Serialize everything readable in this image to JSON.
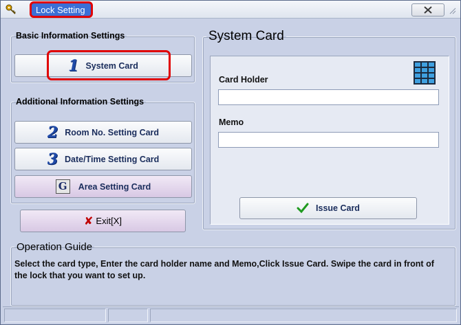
{
  "window": {
    "title": "Lock Setting"
  },
  "icons": {
    "app": "key-icon",
    "close": "close-icon",
    "keypad": "keypad-icon",
    "exit": "x-icon",
    "issue": "check-icon"
  },
  "basic_group": {
    "legend": "Basic Information Settings",
    "buttons": [
      {
        "num": "1",
        "label": "System Card"
      }
    ]
  },
  "additional_group": {
    "legend": "Additional Information Settings",
    "buttons": [
      {
        "num": "2",
        "label": "Room No. Setting Card"
      },
      {
        "num": "3",
        "label": "Date/Time Setting Card"
      },
      {
        "num": "G",
        "label": "Area Setting Card"
      }
    ]
  },
  "exit_button": {
    "label": "Exit",
    "shortcut": "X"
  },
  "system_card": {
    "legend": "System Card",
    "card_holder_label": "Card Holder",
    "card_holder_value": "",
    "memo_label": "Memo",
    "memo_value": "",
    "issue_label": "Issue Card"
  },
  "guide": {
    "legend": "Operation Guide",
    "text": "Select the card type, Enter the card holder name and Memo,Click Issue Card. Swipe the card in front of the  lock that you want to set up."
  },
  "colors": {
    "window_bg": "#c9d1e6",
    "title_bg": "#3b6fd6",
    "highlight": "#e00000",
    "number_blue": "#1f4aa8",
    "area_button": "#d8c8e4"
  }
}
